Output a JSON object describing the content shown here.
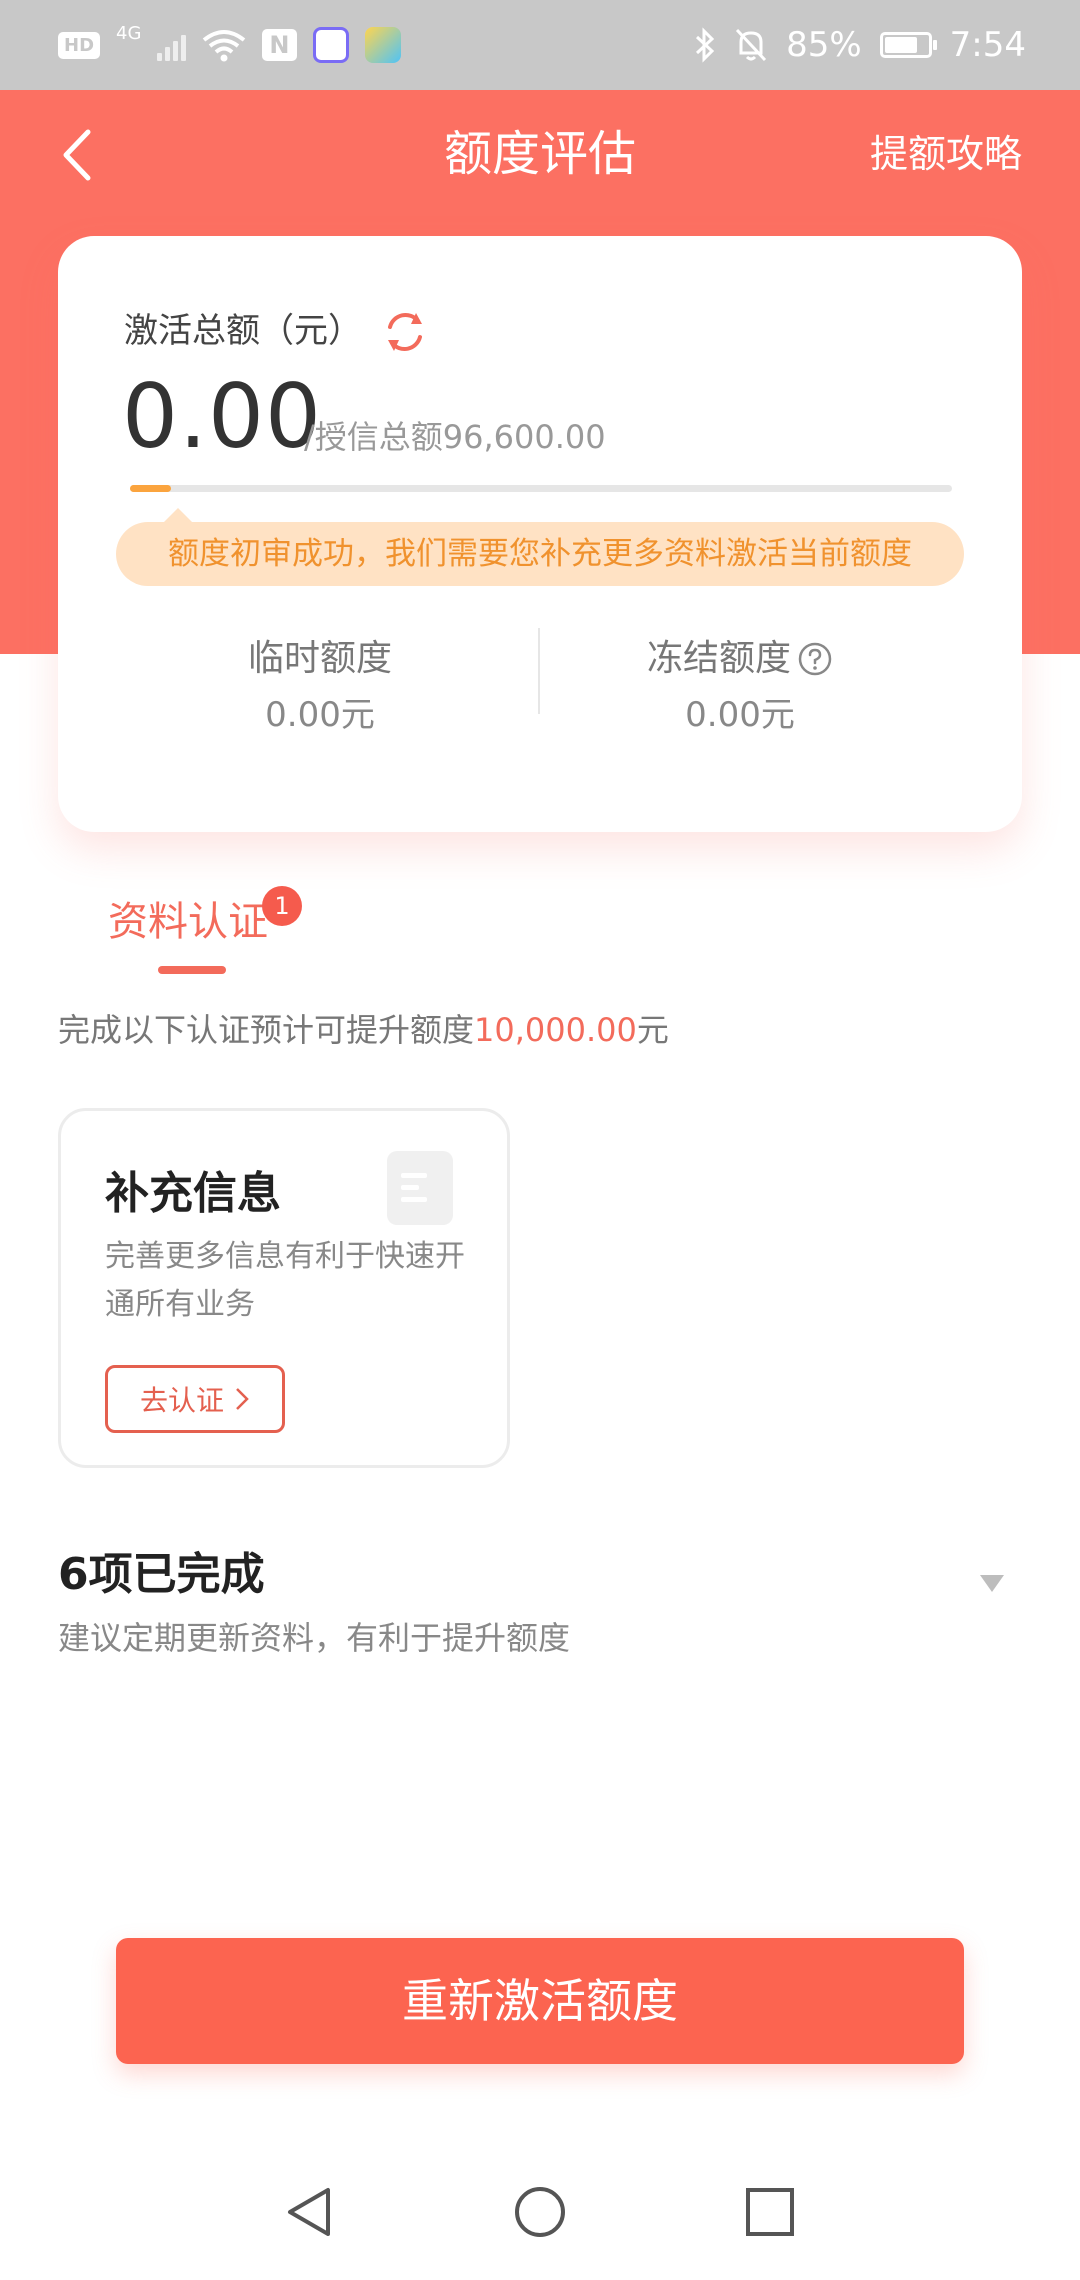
{
  "status_bar": {
    "hd_label": "HD",
    "network_label": "4G",
    "nfc_label": "N",
    "battery": "85%",
    "time": "7:54"
  },
  "header": {
    "title": "额度评估",
    "link_label": "提额攻略"
  },
  "summary": {
    "label": "激活总额（元）",
    "activated_amount": "0.00",
    "total_credit_text": "/授信总额96,600.00",
    "progress": 0.05,
    "notice": "额度初审成功，我们需要您补充更多资料激活当前额度",
    "temp_label": "临时额度",
    "temp_value": "0.00元",
    "frozen_label": "冻结额度",
    "frozen_value": "0.00元"
  },
  "tab": {
    "label": "资料认证",
    "badge": "1"
  },
  "hint": {
    "prefix": "完成以下认证预计可提升额度",
    "amount": "10,000.00",
    "suffix": "元"
  },
  "info_card": {
    "title": "补充信息",
    "desc": "完善更多信息有利于快速开通所有业务",
    "button_label": "去认证"
  },
  "completed": {
    "title": "6项已完成",
    "subtitle": "建议定期更新资料，有利于提升额度"
  },
  "main_button": {
    "label": "重新激活额度"
  },
  "colors": {
    "brand": "#fc7062",
    "accent_orange": "#f0922e",
    "button": "#fc6450"
  }
}
